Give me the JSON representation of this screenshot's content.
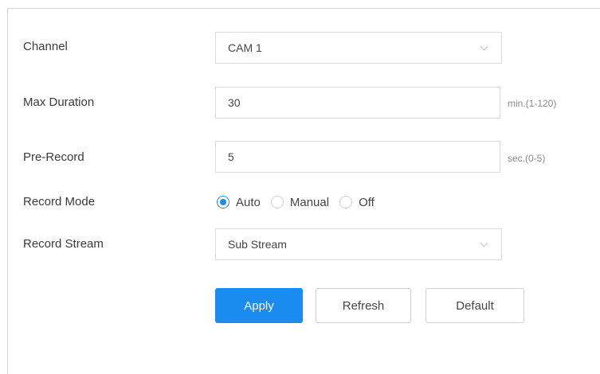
{
  "form": {
    "channel": {
      "label": "Channel",
      "value": "CAM 1"
    },
    "max_duration": {
      "label": "Max Duration",
      "value": "30",
      "hint": "min.(1-120)"
    },
    "pre_record": {
      "label": "Pre-Record",
      "value": "5",
      "hint": "sec.(0-5)"
    },
    "record_mode": {
      "label": "Record Mode",
      "options": [
        "Auto",
        "Manual",
        "Off"
      ],
      "selected": "Auto"
    },
    "record_stream": {
      "label": "Record Stream",
      "value": "Sub Stream"
    }
  },
  "buttons": {
    "apply": "Apply",
    "refresh": "Refresh",
    "default": "Default"
  },
  "colors": {
    "accent": "#1a8cf0"
  }
}
